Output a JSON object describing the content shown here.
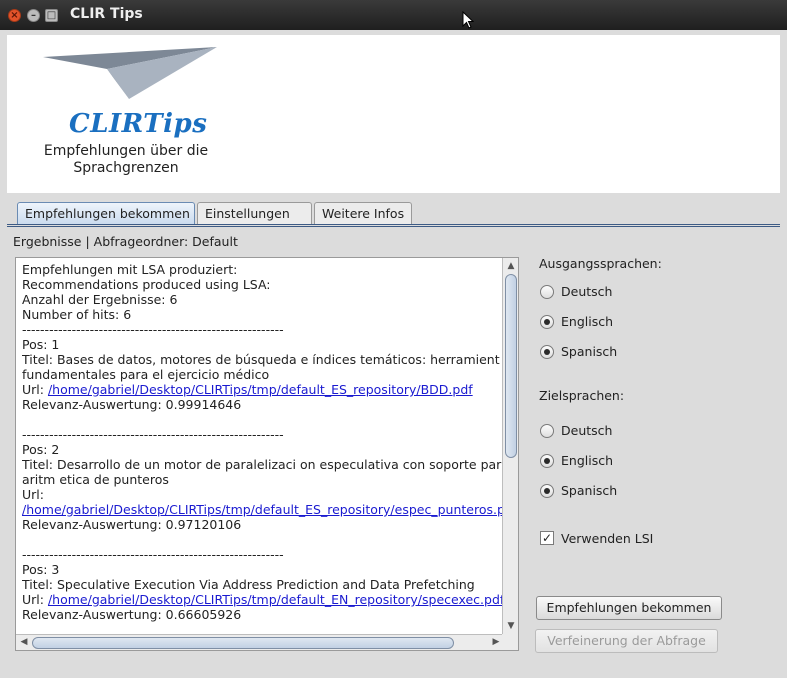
{
  "window": {
    "title": "CLIR Tips",
    "close_glyph": "×",
    "minimize_glyph": "–",
    "maximize_glyph": "□"
  },
  "banner": {
    "logo_text": "CLIRTips",
    "subtitle_line1": "Empfehlungen über die",
    "subtitle_line2": "Sprachgrenzen"
  },
  "tabs": [
    {
      "label": "Empfehlungen bekommen",
      "active": true
    },
    {
      "label": "Einstellungen",
      "active": false
    },
    {
      "label": "Weitere Infos",
      "active": false
    }
  ],
  "results_header": "Ergebnisse | Abfrageordner: Default",
  "results": {
    "intro": [
      "Empfehlungen mit LSA produziert:",
      "Recommendations produced using LSA:",
      "Anzahl der Ergebnisse: 6",
      "Number of hits: 6"
    ],
    "separator": "----------------------------------------------------------",
    "entries": [
      {
        "pos": "Pos: 1",
        "title_lines": [
          "Titel: Bases de datos, motores de búsqueda e índices temáticos: herramient",
          "fundamentales para el ejercicio médico"
        ],
        "url_label": "Url: ",
        "url": "/home/gabriel/Desktop/CLIRTips/tmp/default_ES_repository/BDD.pdf",
        "url_on_new_line": false,
        "score": "Relevanz-Auswertung: 0.99914646"
      },
      {
        "pos": "Pos: 2",
        "title_lines": [
          "Titel: Desarrollo de un motor de paralelizaci on especulativa con soporte par",
          "aritm etica de punteros"
        ],
        "url_label": "Url:",
        "url": "/home/gabriel/Desktop/CLIRTips/tmp/default_ES_repository/espec_punteros.p",
        "url_on_new_line": true,
        "score": "Relevanz-Auswertung: 0.97120106"
      },
      {
        "pos": "Pos: 3",
        "title_lines": [
          "Titel: Speculative Execution Via Address Prediction and Data Prefetching"
        ],
        "url_label": "Url: ",
        "url": "/home/gabriel/Desktop/CLIRTips/tmp/default_EN_repository/specexec.pdf",
        "url_on_new_line": false,
        "score": "Relevanz-Auswertung: 0.66605926"
      }
    ]
  },
  "source_languages": {
    "label": "Ausgangssprachen:",
    "options": [
      {
        "label": "Deutsch",
        "checked": false
      },
      {
        "label": "Englisch",
        "checked": true
      },
      {
        "label": "Spanisch",
        "checked": true
      }
    ]
  },
  "target_languages": {
    "label": "Zielsprachen:",
    "options": [
      {
        "label": "Deutsch",
        "checked": false
      },
      {
        "label": "Englisch",
        "checked": true
      },
      {
        "label": "Spanisch",
        "checked": true
      }
    ]
  },
  "use_lsi": {
    "label": "Verwenden LSI",
    "checked": true,
    "mark": "✓"
  },
  "buttons": {
    "get_recommendations": "Empfehlungen bekommen",
    "refine_query": "Verfeinerung der Abfrage"
  },
  "colors": {
    "link": "#1a1ad0",
    "logo": "#1a6fc0"
  }
}
